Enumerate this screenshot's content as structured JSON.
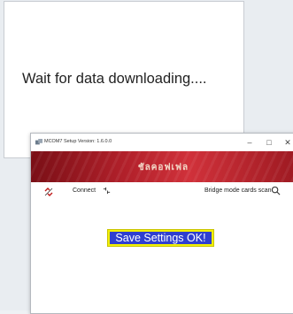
{
  "dialog": {
    "message": "Wait for data downloading...."
  },
  "app": {
    "window_title": "MCOM7 Setup Version: 1.6.0.0",
    "brand": "ชัลคอฟเฟล",
    "toolbar": {
      "connect_label": "Connect",
      "bridge_label": "Bridge mode cards scan"
    },
    "status_message": "Save Settings OK!"
  },
  "colors": {
    "banner_red": "#b1202a",
    "status_bg": "#2f3fd0",
    "status_border": "#f2f000"
  },
  "icons": [
    "link-broken-icon",
    "connect-icon",
    "search-icon",
    "app-icon"
  ]
}
